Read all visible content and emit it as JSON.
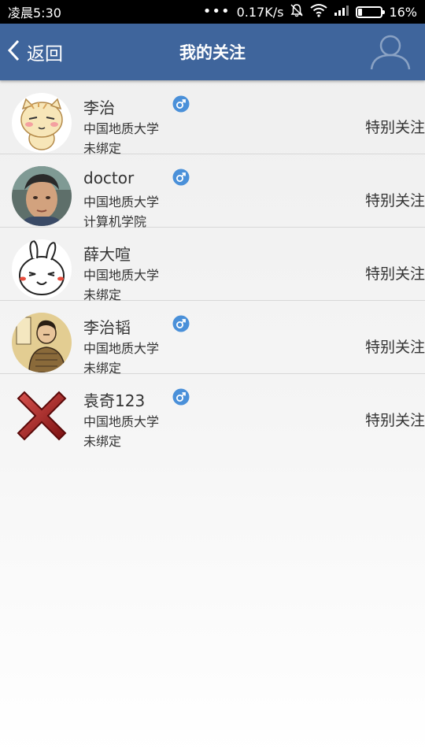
{
  "status_bar": {
    "time": "凌晨5:30",
    "dots": "•••",
    "net_speed": "0.17K/s",
    "battery_percent": "16%",
    "battery_level": 0.16
  },
  "header": {
    "back_label": "返回",
    "title": "我的关注"
  },
  "follows": [
    {
      "name": "李治",
      "school": "中国地质大学",
      "status": "未绑定",
      "gender": "male",
      "action": "特别关注"
    },
    {
      "name": "doctor",
      "school": "中国地质大学",
      "status": "计算机学院",
      "gender": "male",
      "action": "特别关注"
    },
    {
      "name": "薛大喧",
      "school": "中国地质大学",
      "status": "未绑定",
      "gender": "none",
      "action": "特别关注"
    },
    {
      "name": "李治韬",
      "school": "中国地质大学",
      "status": "未绑定",
      "gender": "male",
      "action": "特别关注"
    },
    {
      "name": "袁奇123",
      "school": "中国地质大学",
      "status": "未绑定",
      "gender": "male",
      "action": "特别关注"
    }
  ],
  "colors": {
    "header_bg": "#3f659c",
    "gender_male": "#4a90d9"
  }
}
